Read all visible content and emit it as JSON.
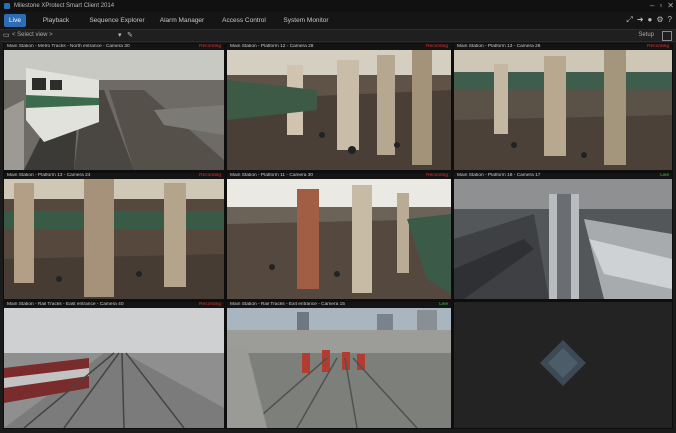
{
  "titlebar": {
    "title": "Milestone XProtect Smart Client 2014"
  },
  "tabs": [
    {
      "label": "Live",
      "active": true
    },
    {
      "label": "Playback",
      "active": false
    },
    {
      "label": "Sequence Explorer",
      "active": false
    },
    {
      "label": "Alarm Manager",
      "active": false
    },
    {
      "label": "Access Control",
      "active": false
    },
    {
      "label": "System Monitor",
      "active": false
    }
  ],
  "toolbar": {
    "view_select": "< Select view >",
    "setup_label": "Setup"
  },
  "cameras": [
    {
      "name": "Main Station - Metro Tracks - North entrance - Camera 30",
      "status": "Recording"
    },
    {
      "name": "Main Station - Platform 12 - Camera 28",
      "status": "Recording"
    },
    {
      "name": "Main Station - Platform 13 - Camera 26",
      "status": "Recording"
    },
    {
      "name": "Main Station - Platform 13 - Camera 24",
      "status": "Recording"
    },
    {
      "name": "Main Station - Platform 11 - Camera 30",
      "status": "Recording"
    },
    {
      "name": "Main Station - Platform 18 - Camera 17",
      "status": "Live"
    },
    {
      "name": "Main Station - Rail Tracks - East entrance - Camera 40",
      "status": "Recording"
    },
    {
      "name": "Main Station - Rail Tracks - Exit entrance - Camera 15",
      "status": "Live"
    }
  ],
  "colors": {
    "accent": "#2c6db5",
    "recording": "#e03030",
    "live": "#46c246"
  }
}
